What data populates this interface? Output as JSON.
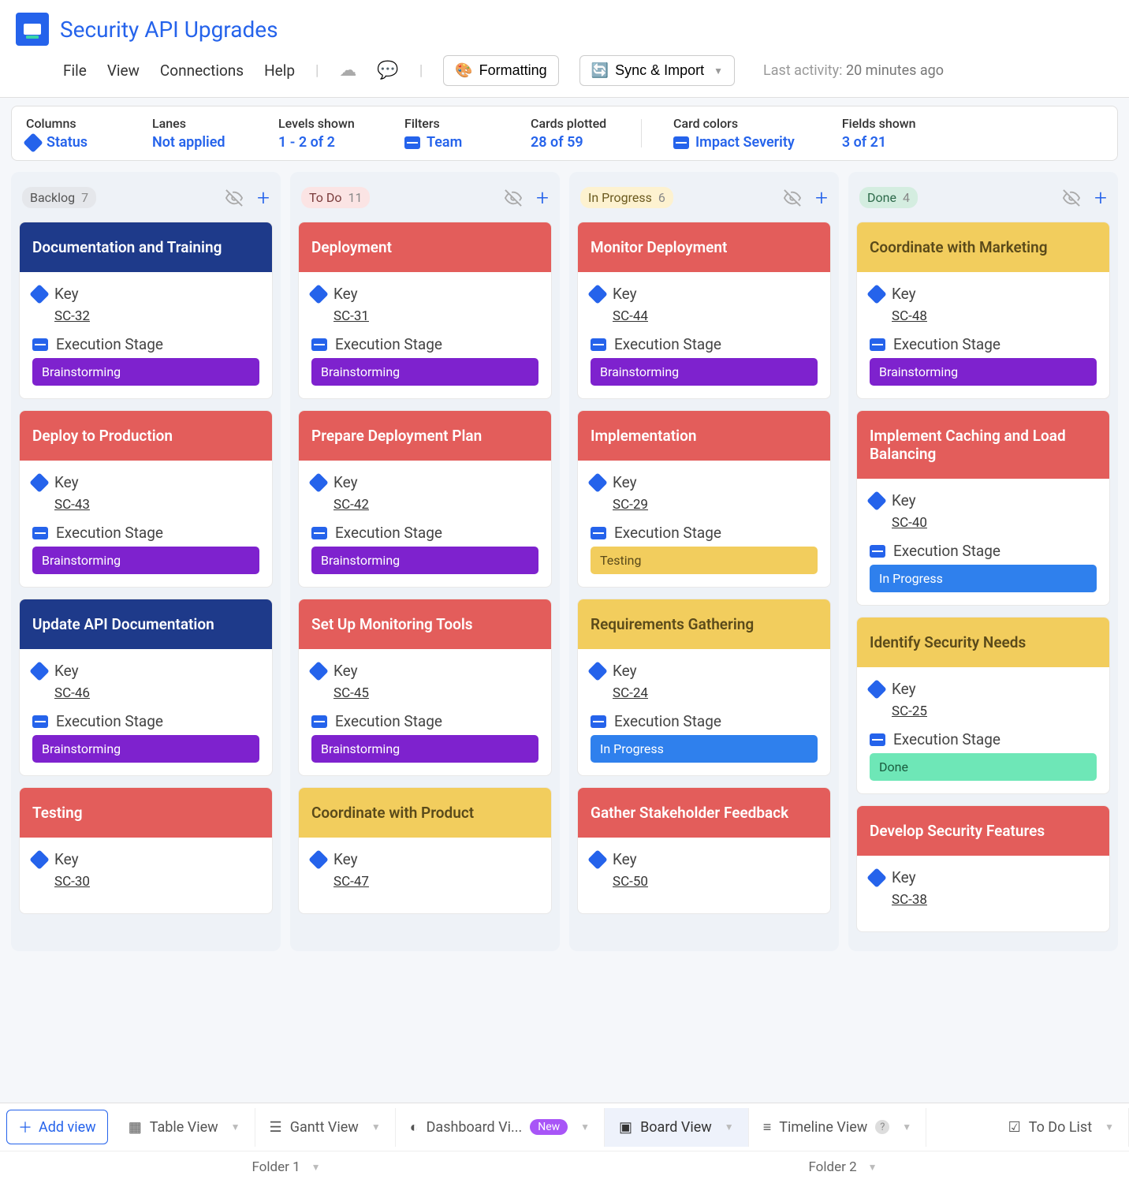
{
  "header": {
    "title": "Security API Upgrades"
  },
  "menu": {
    "file": "File",
    "view": "View",
    "connections": "Connections",
    "help": "Help",
    "formatting": "Formatting",
    "sync": "Sync & Import",
    "activity_label": "Last activity:",
    "activity_time": "20 minutes ago"
  },
  "config": {
    "columns": {
      "label": "Columns",
      "value": "Status"
    },
    "lanes": {
      "label": "Lanes",
      "value": "Not applied"
    },
    "levels": {
      "label": "Levels shown",
      "value": "1 - 2 of 2"
    },
    "filters": {
      "label": "Filters",
      "value": "Team"
    },
    "plotted": {
      "label": "Cards plotted",
      "value": "28 of 59"
    },
    "colors": {
      "label": "Card colors",
      "value": "Impact Severity"
    },
    "fields": {
      "label": "Fields shown",
      "value": "3 of 21"
    }
  },
  "field_labels": {
    "key": "Key",
    "stage": "Execution Stage"
  },
  "columns": [
    {
      "id": "backlog",
      "name": "Backlog",
      "count": "7",
      "pill": "pill-backlog",
      "cards": [
        {
          "title": "Documentation and Training",
          "head": "hd-darkblue",
          "key": "SC-32",
          "stage": "Brainstorming",
          "chip": "chip-purple"
        },
        {
          "title": "Deploy to Production",
          "head": "hd-red",
          "key": "SC-43",
          "stage": "Brainstorming",
          "chip": "chip-purple"
        },
        {
          "title": "Update API Documentation",
          "head": "hd-darkblue",
          "key": "SC-46",
          "stage": "Brainstorming",
          "chip": "chip-purple"
        },
        {
          "title": "Testing",
          "head": "hd-red",
          "key": "SC-30",
          "stage": "",
          "chip": ""
        }
      ]
    },
    {
      "id": "todo",
      "name": "To Do",
      "count": "11",
      "pill": "pill-todo",
      "cards": [
        {
          "title": "Deployment",
          "head": "hd-red",
          "key": "SC-31",
          "stage": "Brainstorming",
          "chip": "chip-purple"
        },
        {
          "title": "Prepare Deployment Plan",
          "head": "hd-red",
          "key": "SC-42",
          "stage": "Brainstorming",
          "chip": "chip-purple"
        },
        {
          "title": "Set Up Monitoring Tools",
          "head": "hd-red",
          "key": "SC-45",
          "stage": "Brainstorming",
          "chip": "chip-purple"
        },
        {
          "title": "Coordinate with Product",
          "head": "hd-yellow",
          "key": "SC-47",
          "stage": "",
          "chip": ""
        }
      ]
    },
    {
      "id": "inprogress",
      "name": "In Progress",
      "count": "6",
      "pill": "pill-inprogress",
      "cards": [
        {
          "title": "Monitor Deployment",
          "head": "hd-red",
          "key": "SC-44",
          "stage": "Brainstorming",
          "chip": "chip-purple"
        },
        {
          "title": "Implementation",
          "head": "hd-red",
          "key": "SC-29",
          "stage": "Testing",
          "chip": "chip-yellow"
        },
        {
          "title": "Requirements Gathering",
          "head": "hd-yellow",
          "key": "SC-24",
          "stage": "In Progress",
          "chip": "chip-blue"
        },
        {
          "title": "Gather Stakeholder Feedback",
          "head": "hd-red",
          "key": "SC-50",
          "stage": "",
          "chip": ""
        }
      ]
    },
    {
      "id": "done",
      "name": "Done",
      "count": "4",
      "pill": "pill-done",
      "cards": [
        {
          "title": "Coordinate with Marketing",
          "head": "hd-yellow",
          "key": "SC-48",
          "stage": "Brainstorming",
          "chip": "chip-purple"
        },
        {
          "title": "Implement Caching and Load Balancing",
          "head": "hd-red",
          "key": "SC-40",
          "stage": "In Progress",
          "chip": "chip-blue"
        },
        {
          "title": "Identify Security Needs",
          "head": "hd-yellow",
          "key": "SC-25",
          "stage": "Done",
          "chip": "chip-green"
        },
        {
          "title": "Develop Security Features",
          "head": "hd-red",
          "key": "SC-38",
          "stage": "",
          "chip": ""
        }
      ]
    }
  ],
  "bottom": {
    "add_view": "Add view",
    "tabs": [
      {
        "name": "Table View",
        "badge": "",
        "help": false
      },
      {
        "name": "Gantt View",
        "badge": "",
        "help": false
      },
      {
        "name": "Dashboard Vi...",
        "badge": "New",
        "help": false
      },
      {
        "name": "Board View",
        "badge": "",
        "help": false,
        "active": true
      },
      {
        "name": "Timeline View",
        "badge": "",
        "help": true
      },
      {
        "name": "To Do List",
        "badge": "",
        "help": false,
        "right": true
      }
    ],
    "folders": [
      "Folder 1",
      "Folder 2"
    ]
  }
}
